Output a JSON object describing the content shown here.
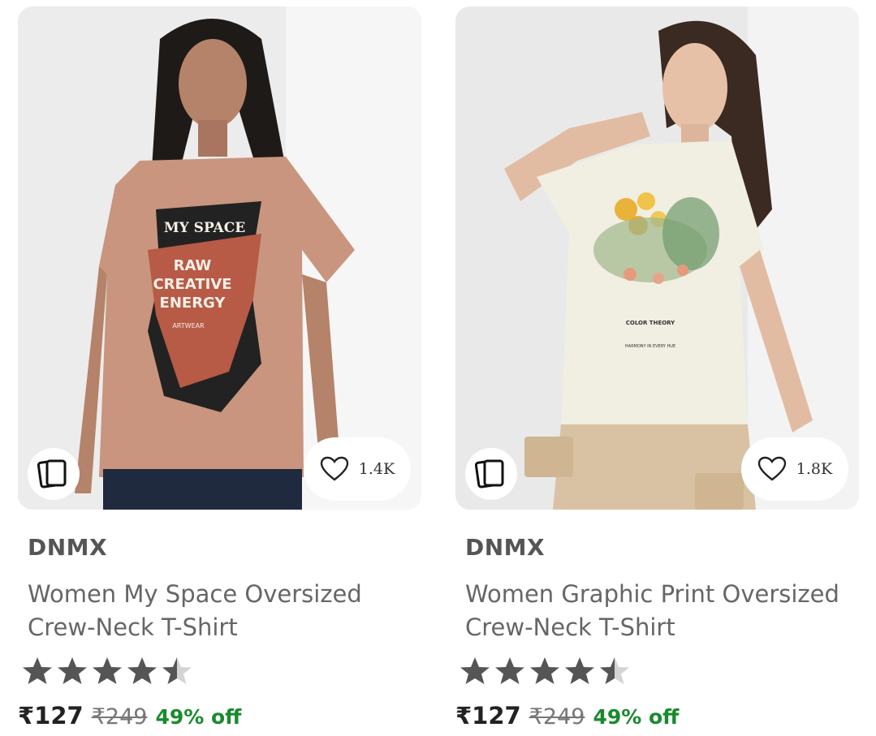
{
  "products": [
    {
      "brand": "DNMX",
      "title": "Women My Space Oversized Crew-Neck T-Shirt",
      "wishlist_count": "1.4K",
      "rating": 4.5,
      "price": "₹127",
      "mrp": "₹249",
      "discount": "49% off",
      "shirt_color": "#c9957e",
      "print_text": [
        "MY SPACE",
        "RAW",
        "CREATIVE",
        "ENERGY",
        "ARTWEAR"
      ]
    },
    {
      "brand": "DNMX",
      "title": "Women Graphic Print Oversized Crew-Neck T-Shirt",
      "wishlist_count": "1.8K",
      "rating": 4.5,
      "price": "₹127",
      "mrp": "₹249",
      "discount": "49% off",
      "shirt_color": "#f1eee2",
      "print_text": [
        "COLOR THEORY",
        "HARMONY IN EVERY HUE"
      ]
    }
  ],
  "icons": {
    "similar": "stacked-cards-icon",
    "wishlist": "heart-icon",
    "star": "star-icon"
  },
  "colors": {
    "discount": "#1a8a2e",
    "star_filled": "#555555",
    "star_empty": "#d4d4d4"
  }
}
